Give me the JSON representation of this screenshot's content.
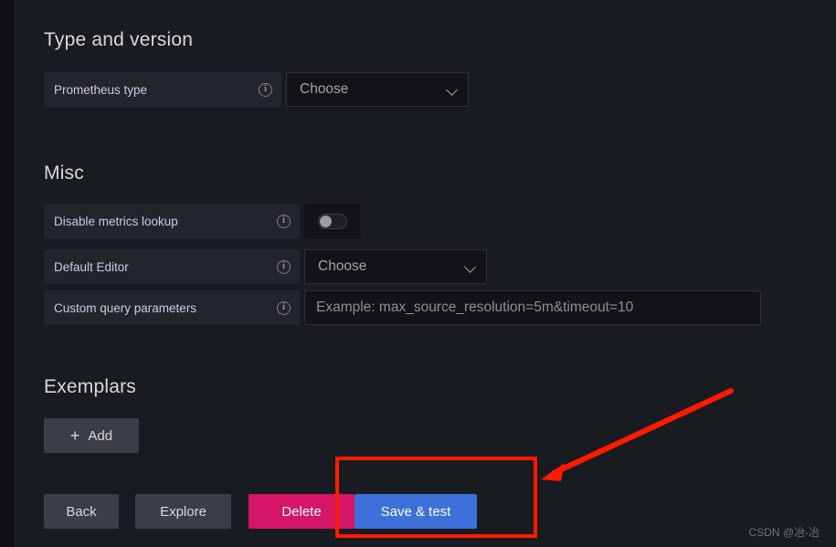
{
  "sections": {
    "type_and_version": {
      "title": "Type and version",
      "prometheus_type": {
        "label": "Prometheus type",
        "info_icon": "info-circle-icon",
        "select_value": "Choose",
        "chevron_icon": "chevron-down-icon"
      }
    },
    "misc": {
      "title": "Misc",
      "disable_metrics_lookup": {
        "label": "Disable metrics lookup",
        "info_icon": "info-circle-icon",
        "toggle_state": "off"
      },
      "default_editor": {
        "label": "Default Editor",
        "info_icon": "info-circle-icon",
        "select_value": "Choose",
        "chevron_icon": "chevron-down-icon"
      },
      "custom_query_parameters": {
        "label": "Custom query parameters",
        "info_icon": "info-circle-icon",
        "value": "",
        "placeholder": "Example: max_source_resolution=5m&timeout=10"
      }
    },
    "exemplars": {
      "title": "Exemplars",
      "add_button": {
        "label": "Add",
        "icon": "plus-icon"
      }
    }
  },
  "footer_buttons": {
    "back": "Back",
    "explore": "Explore",
    "delete": "Delete",
    "save_and_test": "Save & test"
  },
  "annotation": {
    "highlight_color": "#ff1a00",
    "arrow_icon": "arrow-pointing-left-down-icon",
    "target": "Save & test"
  },
  "watermark": "CSDN @冶-冶",
  "colors": {
    "page_background": "#181b1f",
    "rail_background": "#0e1013",
    "field_label_background": "#22252b",
    "input_background": "#111317",
    "primary_button": "#3d71d9",
    "danger_button": "#d51567",
    "secondary_button": "#3b3f45",
    "heading_text": "#d8d9da",
    "label_text": "#ccccdc",
    "placeholder_text": "#8c9197"
  }
}
